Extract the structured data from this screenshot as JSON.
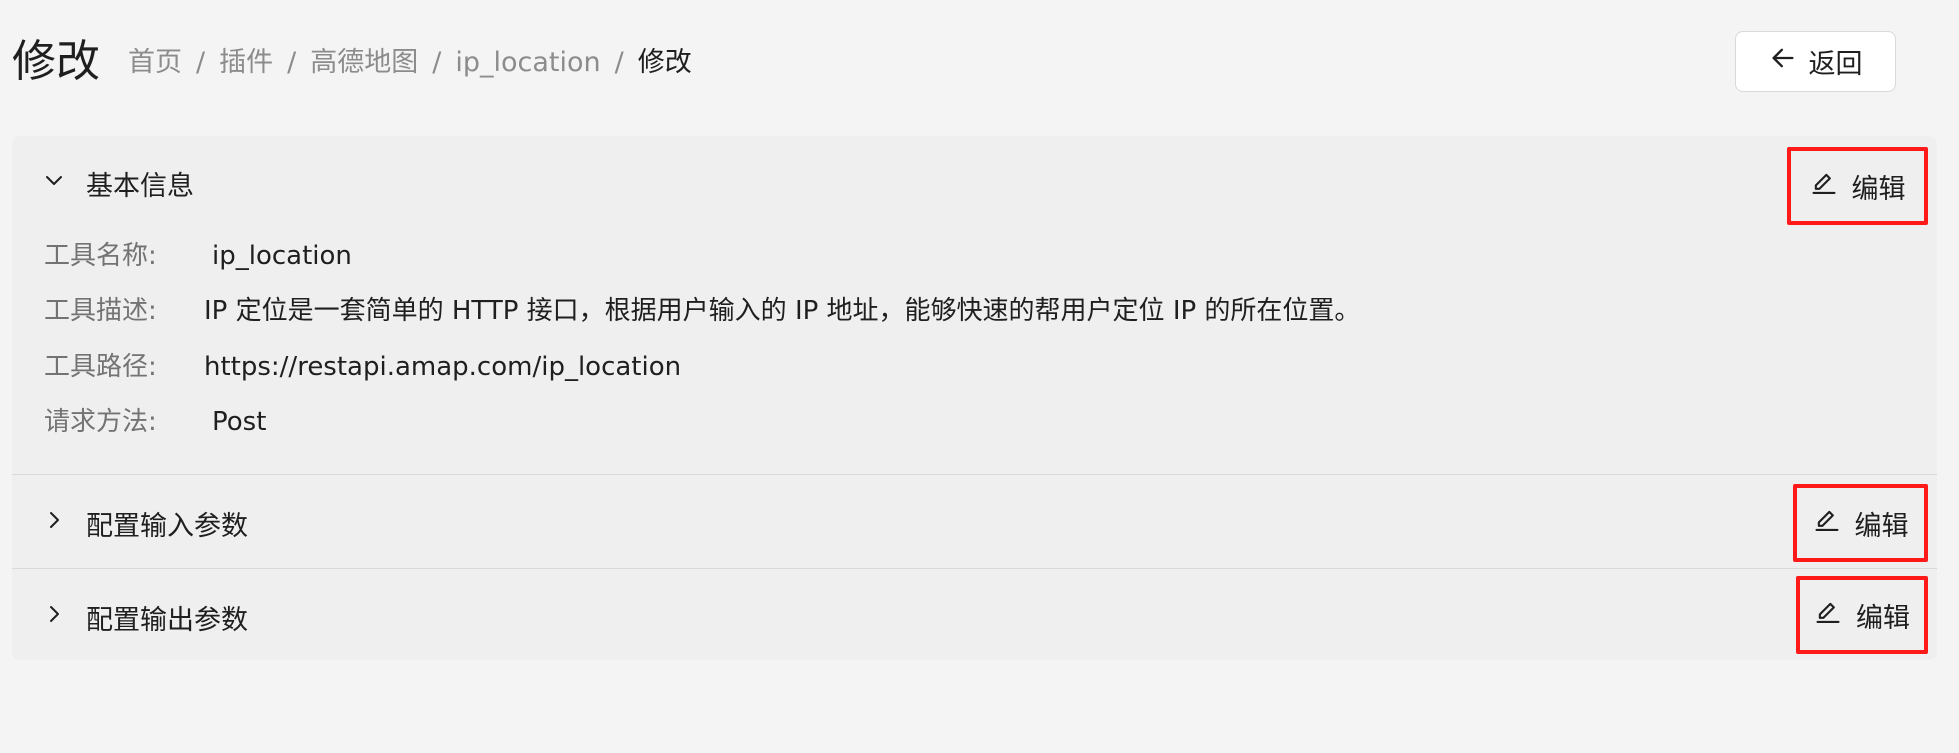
{
  "header": {
    "title": "修改",
    "breadcrumb": [
      "首页",
      "插件",
      "高德地图",
      "ip_location",
      "修改"
    ],
    "separator": "/",
    "back_label": "返回"
  },
  "sections": {
    "basic": {
      "title": "基本信息",
      "expanded": true,
      "edit_label": "编辑",
      "fields": [
        {
          "label": "工具名称:",
          "value": "ip_location"
        },
        {
          "label": "工具描述:",
          "value": "IP 定位是一套简单的 HTTP 接口，根据用户输入的 IP 地址，能够快速的帮用户定位 IP 的所在位置。"
        },
        {
          "label": "工具路径:",
          "value": "https://restapi.amap.com/ip_location"
        },
        {
          "label": "请求方法:",
          "value": "Post"
        }
      ]
    },
    "input": {
      "title": "配置输入参数",
      "expanded": false,
      "edit_label": "编辑"
    },
    "output": {
      "title": "配置输出参数",
      "expanded": false,
      "edit_label": "编辑"
    }
  },
  "icons": {
    "back": "arrow-left-icon",
    "edit": "pencil-icon",
    "expanded": "chevron-down-icon",
    "collapsed": "chevron-right-icon"
  },
  "colors": {
    "highlight_border": "#ff1a1a",
    "background": "#f4f4f4",
    "panel": "#efefef"
  }
}
